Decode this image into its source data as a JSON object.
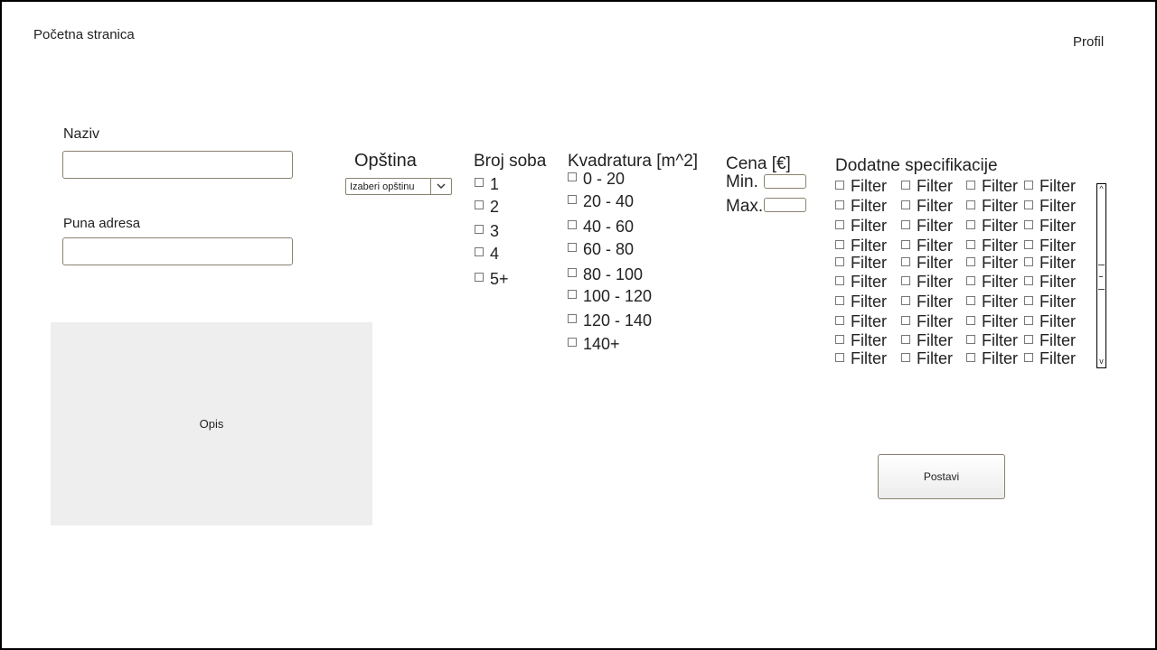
{
  "nav": {
    "home": "Početna stranica",
    "profile": "Profil"
  },
  "form": {
    "name_label": "Naziv",
    "name_value": "",
    "address_label": "Puna adresa",
    "address_value": "",
    "description_label": "Opis"
  },
  "municipality": {
    "title": "Opština",
    "selected": "Izaberi opštinu"
  },
  "rooms": {
    "title": "Broj soba",
    "options": [
      "1",
      "2",
      "3",
      "4",
      "5+"
    ]
  },
  "area": {
    "title": "Kvadratura [m^2]",
    "options": [
      "0 - 20",
      "20 - 40",
      "40 - 60",
      "60 - 80",
      "80 - 100",
      "100 - 120",
      "120 - 140",
      "140+"
    ]
  },
  "price": {
    "title": "Cena [€]",
    "min_label": "Min.",
    "max_label": "Max.",
    "min_value": "",
    "max_value": ""
  },
  "extras": {
    "title": "Dodatne specifikacije",
    "filter_label": "Filter"
  },
  "submit": {
    "label": "Postavi"
  }
}
